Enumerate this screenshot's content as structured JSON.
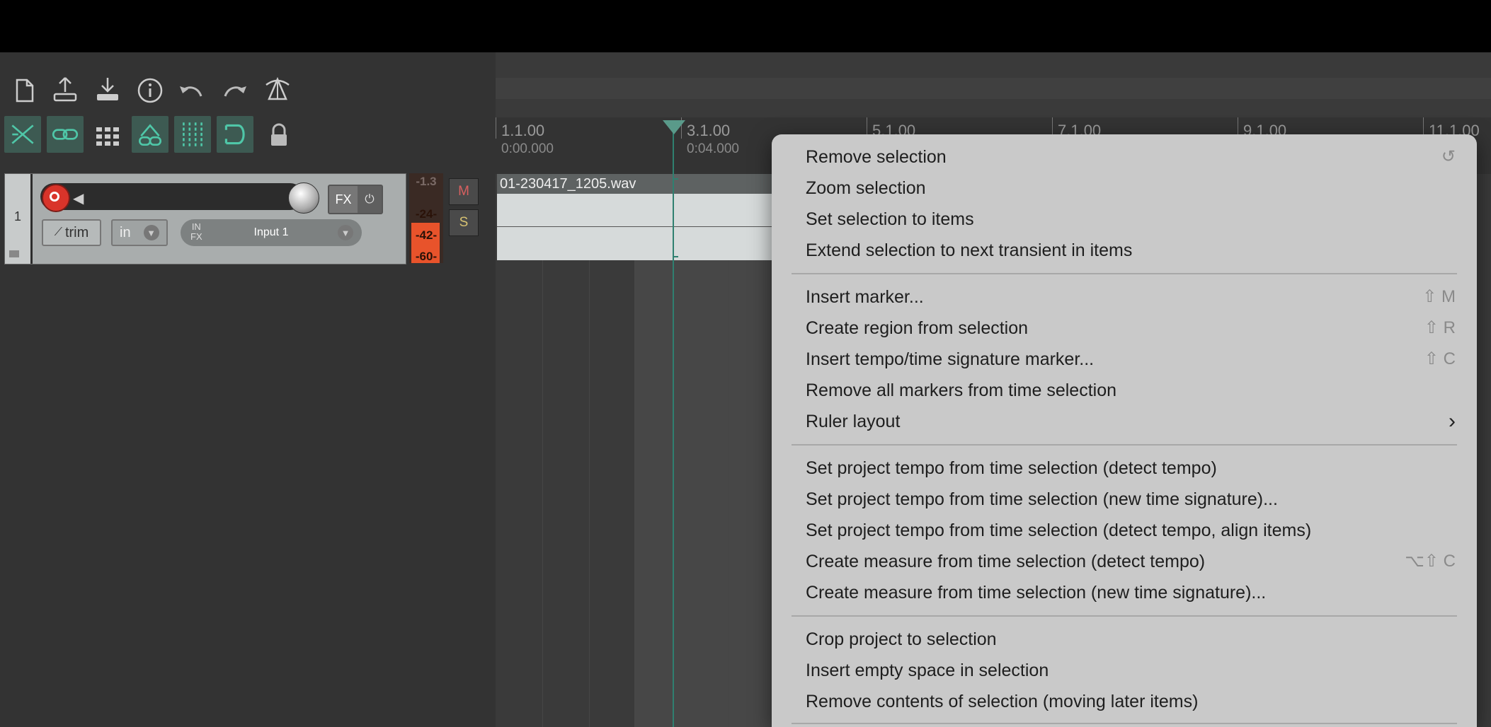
{
  "toolbar": {
    "icons": [
      "new-file-icon",
      "open-project-icon",
      "save-project-icon",
      "info-icon",
      "undo-icon",
      "redo-icon",
      "metronome-icon"
    ],
    "toggles": [
      "ripple-edit-icon",
      "grouping-icon",
      "snap-grid-icon",
      "auto-crossfade-icon",
      "grid-lines-icon",
      "loop-icon",
      "lock-icon"
    ]
  },
  "track": {
    "number": "1",
    "fx_label": "FX",
    "power_glyph": "⏻",
    "trim_label": "trim",
    "in_label": "in",
    "infx_label_line1": "IN",
    "infx_label_line2": "FX",
    "input_label": "Input 1",
    "meter_peak": "-1.3",
    "meter_labels": [
      "-24-",
      "-42-",
      "-60-"
    ],
    "mute_label": "M",
    "solo_label": "S"
  },
  "ruler": {
    "markers": [
      {
        "bar": "1.1.00",
        "time": "0:00.000"
      },
      {
        "bar": "3.1.00",
        "time": "0:04.000"
      },
      {
        "bar": "5.1.00",
        "time": ""
      },
      {
        "bar": "7.1.00",
        "time": ""
      },
      {
        "bar": "9.1.00",
        "time": ""
      },
      {
        "bar": "11.1.00",
        "time": ""
      }
    ]
  },
  "item": {
    "name": "01-230417_1205.wav"
  },
  "context_menu": {
    "items": [
      {
        "label": "Remove selection",
        "shortcut": "↺"
      },
      {
        "label": "Zoom selection",
        "shortcut": ""
      },
      {
        "label": "Set selection to items",
        "shortcut": ""
      },
      {
        "label": "Extend selection to next transient in items",
        "shortcut": ""
      },
      {
        "label": "Insert marker...",
        "shortcut": "⇧ M"
      },
      {
        "label": "Create region from selection",
        "shortcut": "⇧ R"
      },
      {
        "label": "Insert tempo/time signature marker...",
        "shortcut": "⇧ C"
      },
      {
        "label": "Remove all markers from time selection",
        "shortcut": ""
      },
      {
        "label": "Ruler layout",
        "shortcut": "›"
      },
      {
        "label": "Set project tempo from time selection (detect tempo)",
        "shortcut": ""
      },
      {
        "label": "Set project tempo from time selection (new time signature)...",
        "shortcut": ""
      },
      {
        "label": "Set project tempo from time selection (detect tempo, align items)",
        "shortcut": ""
      },
      {
        "label": "Create measure from time selection (detect tempo)",
        "shortcut": "⌥⇧ C"
      },
      {
        "label": "Create measure from time selection (new time signature)...",
        "shortcut": ""
      },
      {
        "label": "Crop project to selection",
        "shortcut": ""
      },
      {
        "label": "Insert empty space in selection",
        "shortcut": ""
      },
      {
        "label": "Remove contents of selection (moving later items)",
        "shortcut": ""
      }
    ]
  },
  "colors": {
    "accent_teal": "#2f8070",
    "record_red": "#d9342a",
    "meter_orange": "#e8532b",
    "menu_bg": "#c9c9c9"
  }
}
